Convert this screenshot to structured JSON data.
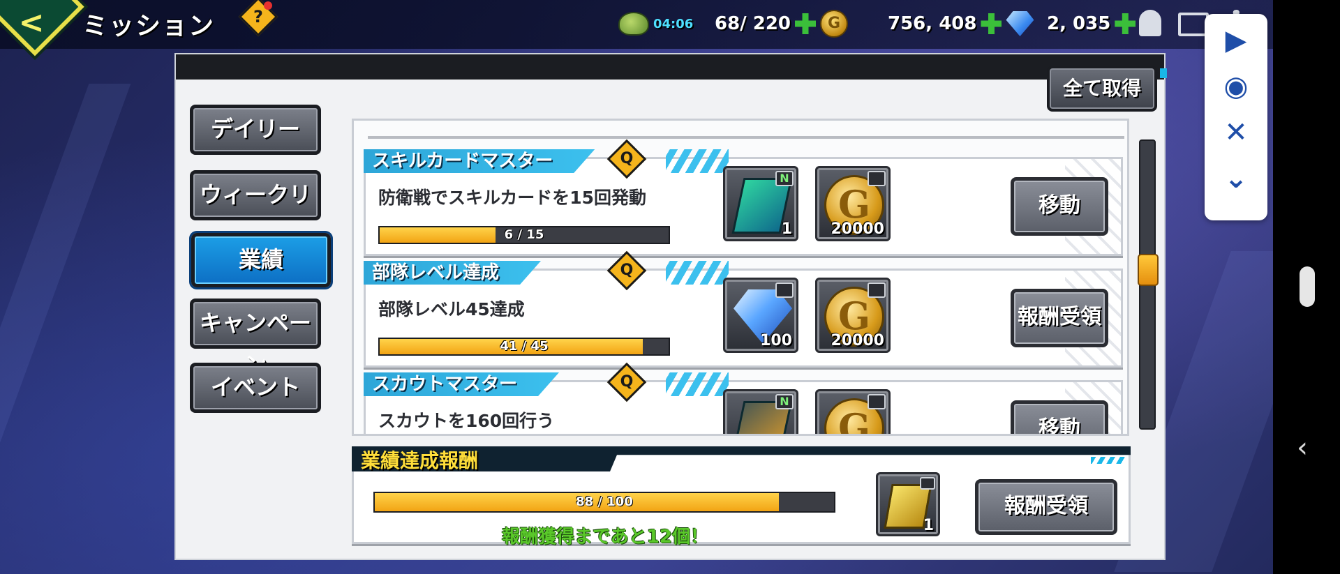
{
  "header": {
    "title": "ミッション",
    "help_glyph": "?",
    "stamina_timer": "04:06",
    "stamina": "68/ 220",
    "coin_glyph": "G",
    "coins": "756, 408",
    "gems": "2, 035",
    "plus_glyph": "+"
  },
  "panel": {
    "claim_all_label": "全て取得"
  },
  "tabs": [
    {
      "label": "デイリー",
      "active": false
    },
    {
      "label": "ウィークリー",
      "active": false
    },
    {
      "label": "業績",
      "active": true
    },
    {
      "label": "キャンペーン",
      "active": false
    },
    {
      "label": "イベント",
      "active": false
    }
  ],
  "missions": [
    {
      "title": "スキルカードマスター",
      "description": "防衛戦でスキルカードを15回発動",
      "progress_text": "6 / 15",
      "progress_fraction": 0.4,
      "rewards": [
        {
          "icon": "skill-card-icon",
          "tag": "N",
          "count": "1"
        },
        {
          "icon": "gold-coin-icon",
          "tag": "",
          "count": "20000"
        }
      ],
      "button_label": "移動"
    },
    {
      "title": "部隊レベル達成",
      "description": "部隊レベル45達成",
      "progress_text": "41 / 45",
      "progress_fraction": 0.911,
      "rewards": [
        {
          "icon": "diamond-icon",
          "tag": "",
          "count": "100"
        },
        {
          "icon": "gold-coin-icon",
          "tag": "",
          "count": "20000"
        }
      ],
      "button_label": "報酬受領"
    },
    {
      "title": "スカウトマスター",
      "description": "スカウトを160回行う",
      "progress_text": "",
      "rewards": [
        {
          "icon": "scout-card-icon",
          "tag": "N",
          "count": ""
        },
        {
          "icon": "gold-coin-icon",
          "tag": "",
          "count": ""
        }
      ],
      "button_label": "移動"
    }
  ],
  "achievement": {
    "title": "業績達成報酬",
    "progress_text": "88 / 100",
    "progress_fraction": 0.88,
    "remaining_text": "報酬獲得まであと12個！",
    "reward_count": "1",
    "button_label": "報酬受領"
  },
  "float_tools": {
    "play_glyph": "▶",
    "eye_glyph": "◉",
    "close_glyph": "✕",
    "collapse_glyph": "⌄"
  },
  "nav": {
    "back_glyph": "‹"
  },
  "colors": {
    "accent_blue": "#1c9ee6",
    "progress_yellow": "#f2a414",
    "header_cyan": "#2da6d8",
    "remaining_green": "#5ac82a",
    "section_title_yellow": "#ffde3a"
  }
}
